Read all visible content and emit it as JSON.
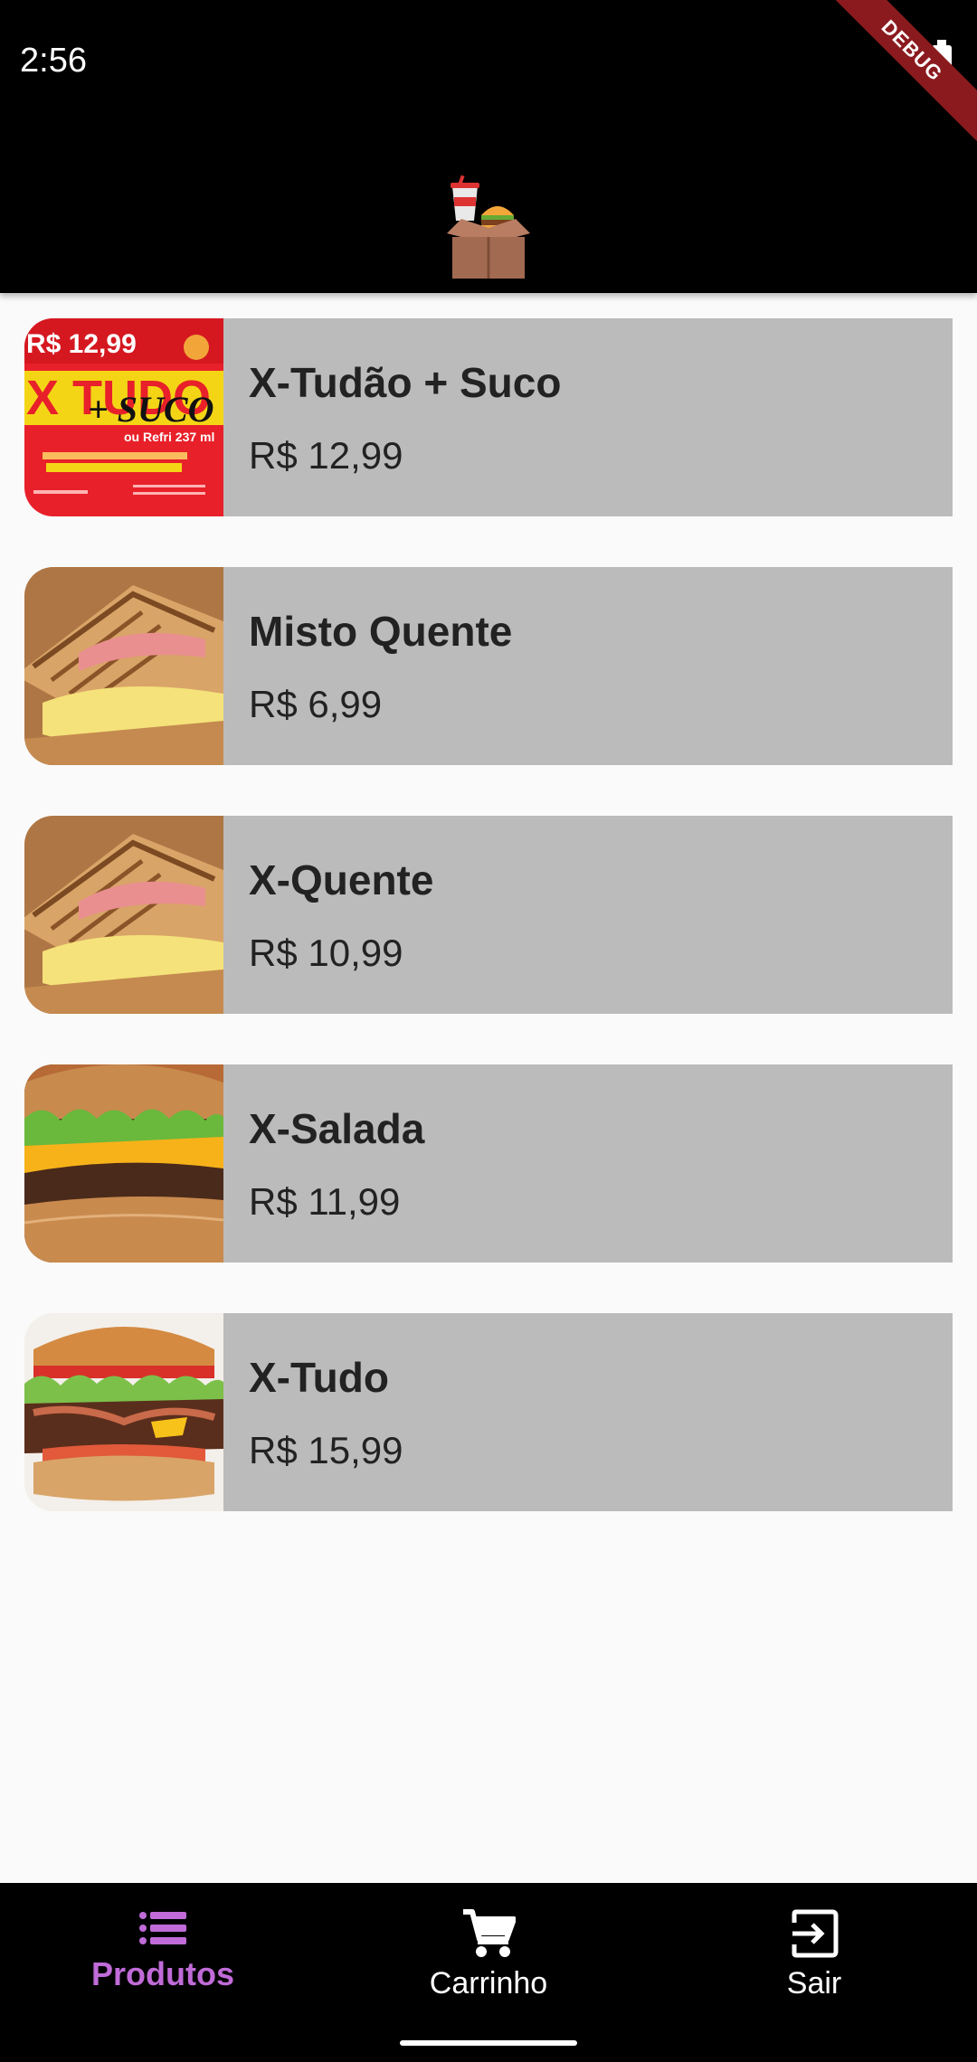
{
  "status": {
    "time": "2:56"
  },
  "debug_banner": "DEBUG",
  "products": [
    {
      "name": "X-Tudão + Suco",
      "price": "R$ 12,99",
      "image": "promo-xtudo-suco",
      "promo": {
        "price": "R$ 12,99",
        "headline": "X TUDO",
        "sub": "+ SUCO",
        "extra": "ou Refri 237 ml"
      }
    },
    {
      "name": "Misto Quente",
      "price": "R$ 6,99",
      "image": "toasted-sandwich"
    },
    {
      "name": "X-Quente",
      "price": "R$ 10,99",
      "image": "toasted-sandwich"
    },
    {
      "name": "X-Salada",
      "price": "R$ 11,99",
      "image": "burger-cheese-lettuce"
    },
    {
      "name": "X-Tudo",
      "price": "R$ 15,99",
      "image": "burger-bacon-tomato"
    }
  ],
  "nav": {
    "items": [
      {
        "label": "Produtos",
        "icon": "list-icon",
        "active": true
      },
      {
        "label": "Carrinho",
        "icon": "cart-icon",
        "active": false
      },
      {
        "label": "Sair",
        "icon": "exit-icon",
        "active": false
      }
    ],
    "active_color": "#c06bd8"
  }
}
